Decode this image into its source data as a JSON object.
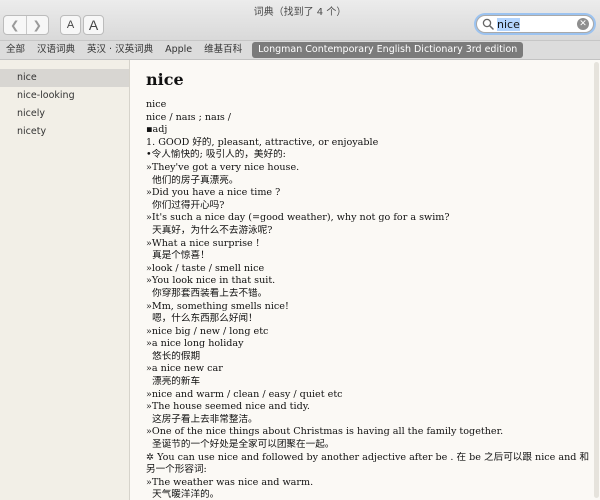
{
  "window": {
    "title": "词典（找到了 4 个）",
    "font_small_label": "A",
    "font_large_label": "A"
  },
  "search": {
    "value": "nice"
  },
  "tabs": [
    {
      "label": "全部"
    },
    {
      "label": "汉语词典"
    },
    {
      "label": "英汉 · 汉英词典"
    },
    {
      "label": "Apple"
    },
    {
      "label": "维基百科"
    },
    {
      "label": "Longman Contemporary English Dictionary 3rd edition",
      "active": true
    }
  ],
  "sidebar": {
    "items": [
      {
        "label": "nice",
        "selected": true
      },
      {
        "label": "nice-looking"
      },
      {
        "label": "nicely"
      },
      {
        "label": "nicety"
      }
    ]
  },
  "entry": {
    "headword": "nice",
    "lines": [
      "nice",
      "nice / naɪs ; naɪs /",
      "▪adj",
      "1. GOOD 好的, pleasant, attractive, or enjoyable",
      "•令人愉快的; 吸引人的，美好的:",
      "»They've got a very nice house.",
      "  他们的房子真漂亮。",
      "»Did you have a nice time ?",
      "  你们过得开心吗?",
      "»It's such a nice day (=good weather), why not go for a swim?",
      "  天真好，为什么不去游泳呢?",
      "»What a nice surprise !",
      "  真是个惊喜！",
      "»look / taste / smell nice",
      "»You look nice in that suit.",
      "  你穿那套西装看上去不错。",
      "»Mm, something smells nice!",
      "  嗯，什么东西那么好闻！",
      "»nice big / new / long etc",
      "»a nice long holiday",
      "  悠长的假期",
      "»a nice new car",
      "  漂亮的新车",
      "»nice and warm / clean / easy / quiet etc",
      "»The house seemed nice and tidy.",
      "  这房子看上去非常整洁。",
      "»One of the nice things about Christmas is having all the family together.",
      "  圣诞节的一个好处是全家可以团聚在一起。",
      "✲ You can use nice and followed by another adjective after be . 在 be 之后可以跟 nice and 和",
      "另一个形容词:",
      "»The weather was nice and warm.",
      "  天气暖洋洋的。"
    ]
  }
}
